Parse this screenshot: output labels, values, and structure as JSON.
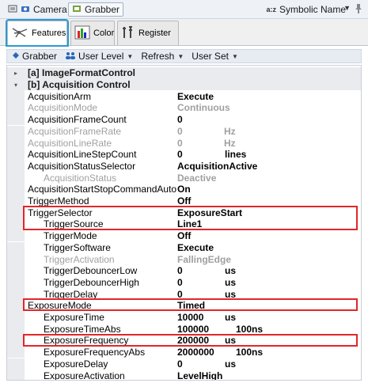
{
  "topbar": {
    "camera_label": "Camera",
    "grabber_label": "Grabber",
    "symbolic_label": "Symbolic Name"
  },
  "tabs": [
    {
      "label": "Features",
      "active": true
    },
    {
      "label": "Color",
      "active": false
    },
    {
      "label": "Register",
      "active": false
    }
  ],
  "toolbar": {
    "grabber": "Grabber",
    "user_level": "User Level",
    "refresh": "Refresh",
    "user_set": "User Set"
  },
  "grid": {
    "categories": [
      {
        "label": "[a] ImageFormatControl",
        "expanded": false
      },
      {
        "label": "[b] Acquisition Control",
        "expanded": true
      }
    ],
    "rows": [
      {
        "name": "AcquisitionArm",
        "value": "Execute",
        "unit": "",
        "enabled": true,
        "indent": false
      },
      {
        "name": "AcquisitionMode",
        "value": "Continuous",
        "unit": "",
        "enabled": false,
        "indent": false
      },
      {
        "name": "AcquisitionFrameCount",
        "value": "0",
        "unit": "",
        "enabled": true,
        "indent": false
      },
      {
        "name": "AcquisitionFrameRate",
        "value": "0",
        "unit": "Hz",
        "enabled": false,
        "indent": false
      },
      {
        "name": "AcquisitionLineRate",
        "value": "0",
        "unit": "Hz",
        "enabled": false,
        "indent": false
      },
      {
        "name": "AcquisitionLineStepCount",
        "value": "0",
        "unit": "lines",
        "enabled": true,
        "indent": false
      },
      {
        "name": "AcquisitionStatusSelector",
        "value": "AcquisitionActive",
        "unit": "",
        "enabled": true,
        "indent": false
      },
      {
        "name": "AcquisitionStatus",
        "value": "Deactive",
        "unit": "",
        "enabled": false,
        "indent": true
      },
      {
        "name": "AcquisitionStartStopCommandAuto",
        "value": "On",
        "unit": "",
        "enabled": true,
        "indent": false
      },
      {
        "name": "TriggerMethod",
        "value": "Off",
        "unit": "",
        "enabled": true,
        "indent": false
      },
      {
        "name": "TriggerSelector",
        "value": "ExposureStart",
        "unit": "",
        "enabled": true,
        "indent": false
      },
      {
        "name": "TriggerSource",
        "value": "Line1",
        "unit": "",
        "enabled": true,
        "indent": true
      },
      {
        "name": "TriggerMode",
        "value": "Off",
        "unit": "",
        "enabled": true,
        "indent": true
      },
      {
        "name": "TriggerSoftware",
        "value": "Execute",
        "unit": "",
        "enabled": true,
        "indent": true
      },
      {
        "name": "TriggerActivation",
        "value": "FallingEdge",
        "unit": "",
        "enabled": false,
        "indent": true
      },
      {
        "name": "TriggerDebouncerLow",
        "value": "0",
        "unit": "us",
        "enabled": true,
        "indent": true
      },
      {
        "name": "TriggerDebouncerHigh",
        "value": "0",
        "unit": "us",
        "enabled": true,
        "indent": true
      },
      {
        "name": "TriggerDelay",
        "value": "0",
        "unit": "us",
        "enabled": true,
        "indent": true
      },
      {
        "name": "ExposureMode",
        "value": "Timed",
        "unit": "",
        "enabled": true,
        "indent": false
      },
      {
        "name": "ExposureTime",
        "value": "10000",
        "unit": "us",
        "enabled": true,
        "indent": true
      },
      {
        "name": "ExposureTimeAbs",
        "value": "100000",
        "unit": "100ns",
        "enabled": true,
        "indent": true
      },
      {
        "name": "ExposureFrequency",
        "value": "200000",
        "unit": "us",
        "enabled": true,
        "indent": true
      },
      {
        "name": "ExposureFrequencyAbs",
        "value": "2000000",
        "unit": "100ns",
        "enabled": true,
        "indent": true
      },
      {
        "name": "ExposureDelay",
        "value": "0",
        "unit": "us",
        "enabled": true,
        "indent": true
      },
      {
        "name": "ExposureActivation",
        "value": "LevelHigh",
        "unit": "",
        "enabled": true,
        "indent": true
      }
    ]
  },
  "colors": {
    "highlight": "#e2262b",
    "tab_focus": "#2a9ad8",
    "disabled_text": "#a0a0a0"
  }
}
